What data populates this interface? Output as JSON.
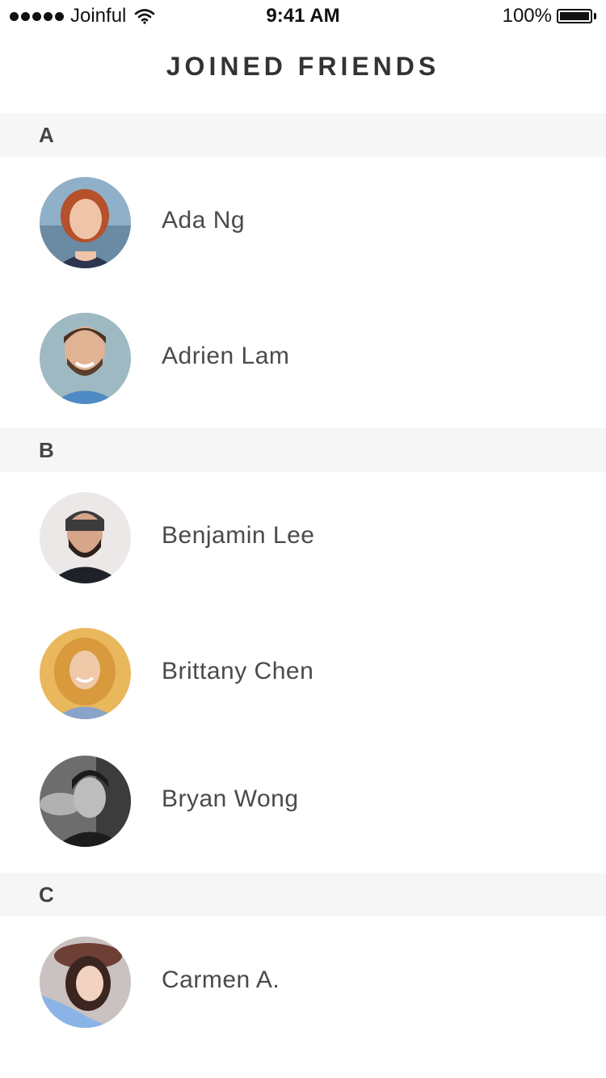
{
  "status_bar": {
    "carrier": "Joinful",
    "time": "9:41 AM",
    "battery": "100%"
  },
  "header": {
    "title": "JOINED FRIENDS"
  },
  "sections": [
    {
      "letter": "A",
      "friends": [
        {
          "name": "Ada Ng"
        },
        {
          "name": "Adrien Lam"
        }
      ]
    },
    {
      "letter": "B",
      "friends": [
        {
          "name": "Benjamin Lee"
        },
        {
          "name": "Brittany Chen"
        },
        {
          "name": "Bryan Wong"
        }
      ]
    },
    {
      "letter": "C",
      "friends": [
        {
          "name": "Carmen A."
        }
      ]
    }
  ],
  "icons": [
    "signal-icon",
    "wifi-icon",
    "battery-icon",
    "avatar-photo"
  ]
}
